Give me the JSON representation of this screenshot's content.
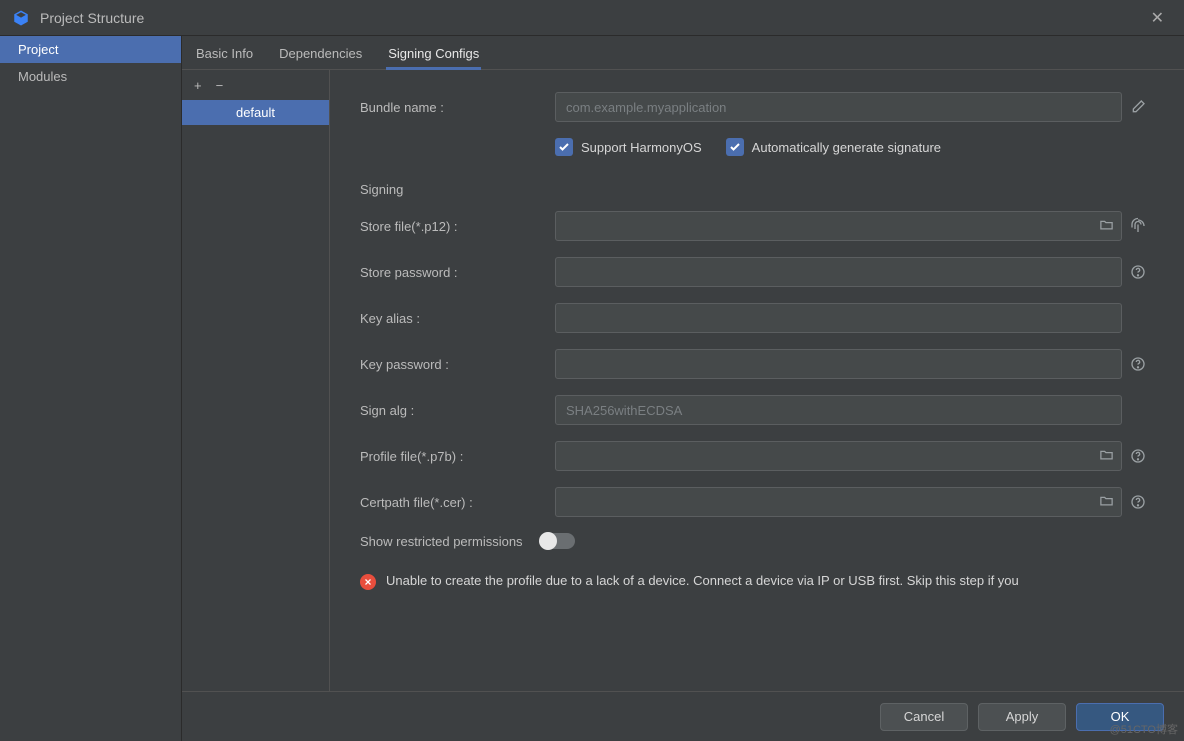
{
  "window": {
    "title": "Project Structure"
  },
  "leftNav": {
    "items": [
      "Project",
      "Modules"
    ],
    "selected": 0
  },
  "tabs": {
    "items": [
      "Basic Info",
      "Dependencies",
      "Signing Configs"
    ],
    "active": 2
  },
  "configList": {
    "items": [
      "default"
    ],
    "selected": 0
  },
  "form": {
    "bundleName": {
      "label": "Bundle name :",
      "placeholder": "com.example.myapplication",
      "value": ""
    },
    "checkboxes": {
      "supportHarmony": {
        "label": "Support HarmonyOS",
        "checked": true
      },
      "autoGenerate": {
        "label": "Automatically generate signature",
        "checked": true
      }
    },
    "signingHeader": "Signing",
    "storeFile": {
      "label": "Store file(*.p12) :",
      "value": ""
    },
    "storePassword": {
      "label": "Store password :",
      "value": ""
    },
    "keyAlias": {
      "label": "Key alias :",
      "value": ""
    },
    "keyPassword": {
      "label": "Key password :",
      "value": ""
    },
    "signAlg": {
      "label": "Sign alg :",
      "placeholder": "SHA256withECDSA",
      "value": ""
    },
    "profileFile": {
      "label": "Profile file(*.p7b) :",
      "value": ""
    },
    "certpathFile": {
      "label": "Certpath file(*.cer) :",
      "value": ""
    },
    "restrictedToggle": {
      "label": "Show restricted permissions",
      "on": false
    },
    "errorMessage": "Unable to create the profile due to a lack of a device. Connect a device via IP or USB first. Skip this step if you"
  },
  "footer": {
    "cancel": "Cancel",
    "apply": "Apply",
    "ok": "OK"
  },
  "watermark": "@51CTO博客"
}
